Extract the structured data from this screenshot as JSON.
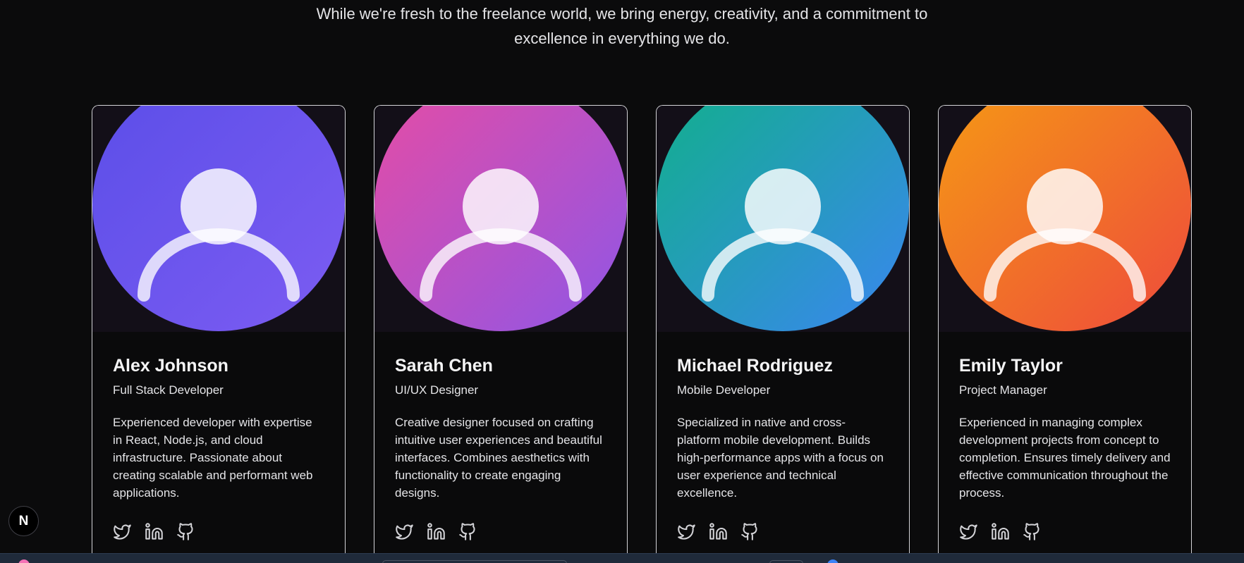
{
  "intro": {
    "line1": "While we're fresh to the freelance world, we bring energy, creativity, and a commitment to",
    "line2": "excellence in everything we do."
  },
  "team": [
    {
      "name": "Alex Johnson",
      "role": "Full Stack Developer",
      "bio": "Experienced developer with expertise in React, Node.js, and cloud infrastructure. Passionate about creating scalable and performant web applications.",
      "gradient": [
        "#5b4ee8",
        "#7c5cf2"
      ]
    },
    {
      "name": "Sarah Chen",
      "role": "UI/UX Designer",
      "bio": "Creative designer focused on crafting intuitive user experiences and beautiful interfaces. Combines aesthetics with functionality to create engaging designs.",
      "gradient": [
        "#e64ca4",
        "#8f56e6"
      ]
    },
    {
      "name": "Michael Rodriguez",
      "role": "Mobile Developer",
      "bio": "Specialized in native and cross-platform mobile development. Builds high-performance apps with a focus on user experience and technical excellence.",
      "gradient": [
        "#11b08a",
        "#3a86f0"
      ]
    },
    {
      "name": "Emily Taylor",
      "role": "Project Manager",
      "bio": "Experienced in managing complex development projects from concept to completion. Ensures timely delivery and effective communication throughout the process.",
      "gradient": [
        "#f59a14",
        "#ee4a3c"
      ]
    }
  ],
  "socials": [
    "twitter-icon",
    "linkedin-icon",
    "github-icon"
  ],
  "badge": {
    "label": "N"
  }
}
